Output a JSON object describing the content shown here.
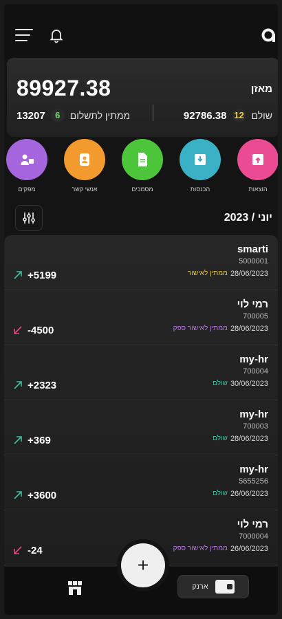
{
  "header": {
    "menu_icon": "hamburger-icon",
    "bell_icon": "bell-icon",
    "logo_icon": "logo-q-icon"
  },
  "balance": {
    "label": "מאזן",
    "amount": "89927.38",
    "paid_label": "שולם",
    "paid_count": "12",
    "paid_amount": "92786.38",
    "pending_label": "ממתין לתשלום",
    "pending_count": "6",
    "pending_amount": "13207"
  },
  "actions": [
    {
      "label": "מפקים",
      "color": "#a565dc",
      "icon": "supplier-icon"
    },
    {
      "label": "אנשי קשר",
      "color": "#f29a2e",
      "icon": "contacts-icon"
    },
    {
      "label": "מסמכים",
      "color": "#4cc53b",
      "icon": "document-icon"
    },
    {
      "label": "הכנסות",
      "color": "#3ab1c5",
      "icon": "income-icon"
    },
    {
      "label": "הוצאות",
      "color": "#ea4b93",
      "icon": "expenses-icon"
    }
  ],
  "period": "יוני / 2023",
  "colors": {
    "status_yellow": "#e4c63a",
    "status_purple": "#b777e0",
    "status_green": "#3fbfa0",
    "arrow_up": "#3fbfa0",
    "arrow_down": "#e04a86"
  },
  "transactions": [
    {
      "name": "smarti",
      "id": "5000001",
      "date": "28/06/2023",
      "status": "ממתין לאישור",
      "status_color": "#e4c63a",
      "amount": "+5199",
      "direction": "up"
    },
    {
      "name": "רמי לוי",
      "id": "700005",
      "date": "28/06/2023",
      "status": "ממתין לאישור ספק",
      "status_color": "#b777e0",
      "amount": "-4500",
      "direction": "down"
    },
    {
      "name": "my-hr",
      "id": "700004",
      "date": "30/06/2023",
      "status": "שולם",
      "status_color": "#3fbfa0",
      "amount": "+2323",
      "direction": "up"
    },
    {
      "name": "my-hr",
      "id": "700003",
      "date": "28/06/2023",
      "status": "שולם",
      "status_color": "#3fbfa0",
      "amount": "+369",
      "direction": "up"
    },
    {
      "name": "my-hr",
      "id": "5655256",
      "date": "26/06/2023",
      "status": "שולם",
      "status_color": "#3fbfa0",
      "amount": "+3600",
      "direction": "up"
    },
    {
      "name": "רמי לוי",
      "id": "7000004",
      "date": "26/06/2023",
      "status": "ממתין לאישור ספק",
      "status_color": "#b777e0",
      "amount": "-24",
      "direction": "down"
    }
  ],
  "bottom_nav": {
    "fab_label": "+",
    "wallet_label": "ארנק",
    "home_icon": "store-icon",
    "wallet_icon": "wallet-icon"
  }
}
